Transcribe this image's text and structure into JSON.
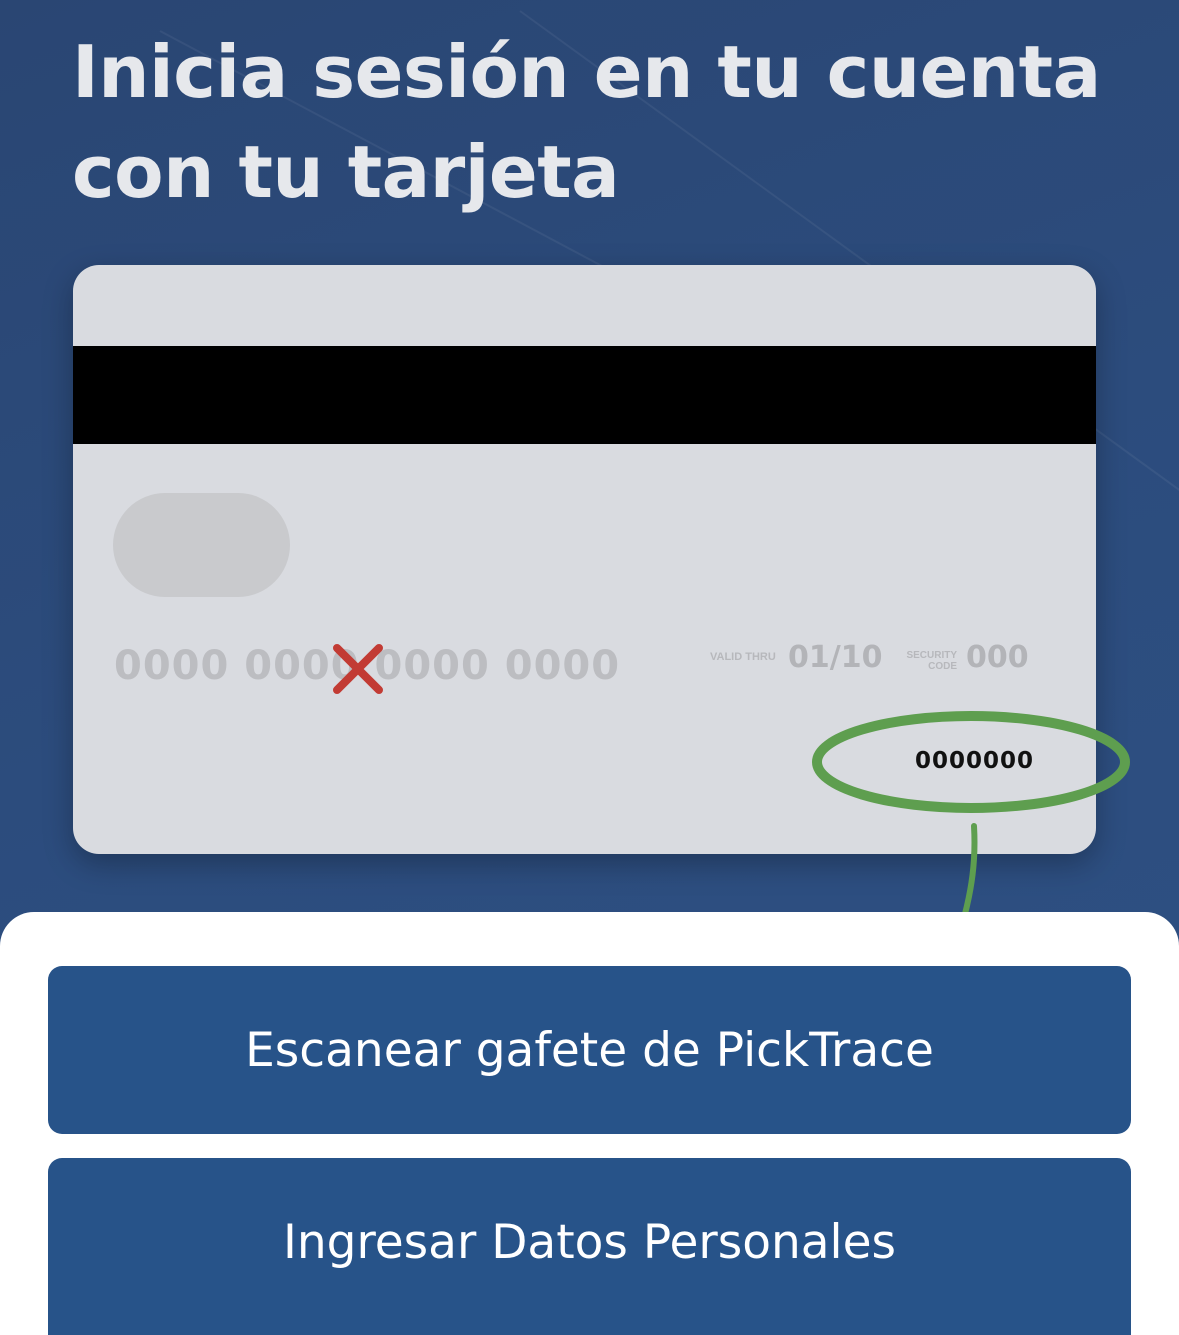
{
  "page": {
    "title": "Inicia sesión en tu cuenta con tu tarjeta"
  },
  "card": {
    "number": "0000 0000 0000 0000",
    "valid_thru_label": "VALID THRU",
    "valid_thru_value": "01/10",
    "security_code_label_line1": "SECURITY",
    "security_code_label_line2": "CODE",
    "security_code_value": "000",
    "serial_number": "0000000"
  },
  "annotations": {
    "highlight_color": "#5e9e4f",
    "x_mark_color": "#c23b34"
  },
  "actions": {
    "scan_badge_label": "Escanear gafete de PickTrace",
    "personal_data_label": "Ingresar Datos Personales"
  },
  "colors": {
    "background": "#2c4c7d",
    "button": "#275389",
    "card": "#d9dbe0"
  }
}
